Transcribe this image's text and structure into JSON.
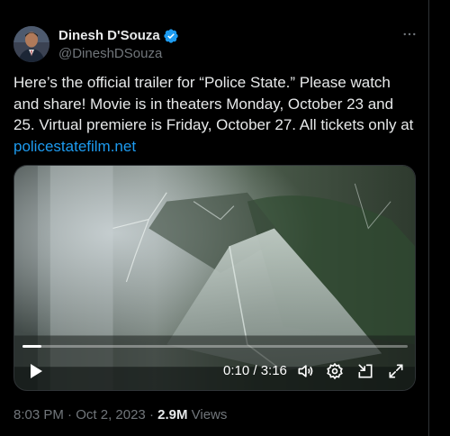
{
  "author": {
    "display_name": "Dinesh D'Souza",
    "handle": "@DineshDSouza",
    "verified": true
  },
  "tweet": {
    "text": "Here’s the official trailer for “Police State.” Please watch and share! Movie is in theaters Monday, October 23 and 25. Virtual premiere is Friday, October 27. All tickets only at",
    "link": "policestatefilm.net"
  },
  "video": {
    "time_display": "0:10 / 3:16",
    "progress_fraction": 0.05
  },
  "footer": {
    "time": "8:03 PM",
    "separator": " · ",
    "date": "Oct 2, 2023",
    "dot": " · ",
    "views_count": "2.9M",
    "views_label": " Views"
  },
  "colors": {
    "background": "#000000",
    "text_primary": "#e7e9ea",
    "text_secondary": "#71767b",
    "link": "#1d9bf0",
    "verified_badge": "#1d9bf0",
    "border": "#2f3336"
  },
  "icons": {
    "more": "more-icon",
    "verified": "verified-badge-icon",
    "play": "play-icon",
    "volume": "volume-icon",
    "settings": "settings-gear-icon",
    "minimize": "minimize-icon",
    "fullscreen": "fullscreen-icon"
  }
}
